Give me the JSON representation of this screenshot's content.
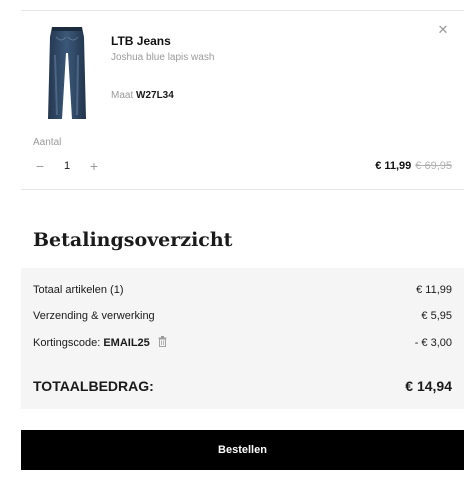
{
  "cart_item": {
    "name": "LTB Jeans",
    "variant": "Joshua blue lapis wash",
    "size_label": "Maat",
    "size_value": "W27L34",
    "remove_icon": "close-icon",
    "quantity_label": "Aantal",
    "quantity": "1",
    "decrement": "−",
    "increment": "+",
    "price_now": "€ 11,99",
    "price_old": "€ 69,95"
  },
  "summary": {
    "title": "Betalingsoverzicht",
    "rows": [
      {
        "label": "Totaal artikelen (1)",
        "value": "€ 11,99"
      },
      {
        "label": "Verzending & verwerking",
        "value": "€ 5,95"
      },
      {
        "label": "Kortingscode:",
        "code": "EMAIL25",
        "icon": "trash-icon",
        "value": "- € 3,00"
      }
    ],
    "total_label": "TOTAALBEDRAG:",
    "total_value": "€ 14,94"
  },
  "order_button": "Bestellen",
  "colors": {
    "button_bg": "#000000",
    "summary_bg": "#f5f5f5",
    "muted_text": "#9a9a9a"
  }
}
